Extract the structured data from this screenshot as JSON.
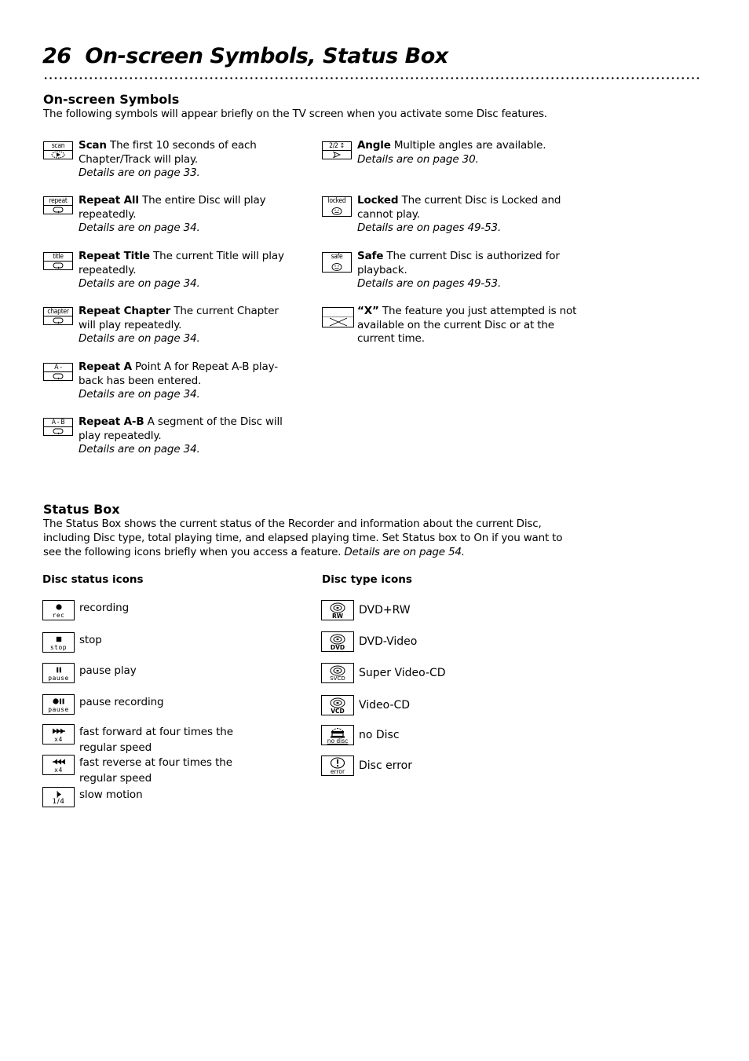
{
  "header": {
    "page_number": "26",
    "title": "On-screen Symbols, Status Box"
  },
  "onscreen": {
    "heading": "On-screen Symbols",
    "intro": "The following symbols will appear briefly on the TV screen when you activate some Disc features.",
    "left": [
      {
        "icon_label": "scan",
        "icon": "scan-play-icon",
        "name": "Scan",
        "desc": " The first 10 seconds of each Chapter/Track will play.",
        "details": "Details are on page 33."
      },
      {
        "icon_label": "repeat",
        "icon": "repeat-icon",
        "name": "Repeat All",
        "desc": " The entire Disc will play repeatedly.",
        "details": "Details are on page 34."
      },
      {
        "icon_label": "title",
        "icon": "repeat-icon",
        "name": "Repeat Title",
        "desc": " The current Title will play repeatedly.",
        "details": "Details are on page 34."
      },
      {
        "icon_label": "chapter",
        "icon": "repeat-icon",
        "name": "Repeat Chapter",
        "desc": " The current Chapter will play repeatedly.",
        "details": "Details are on page 34."
      },
      {
        "icon_label": "A -",
        "icon": "repeat-icon",
        "name": "Repeat A",
        "desc": "  Point A for Repeat A-B play-back has been entered.",
        "details": "Details are on page 34."
      },
      {
        "icon_label": "A - B",
        "icon": "repeat-icon",
        "name": "Repeat A-B",
        "desc": " A segment of the Disc will play repeatedly.",
        "details": "Details are on page 34."
      }
    ],
    "right": [
      {
        "icon_label": "2/2 ↕",
        "icon": "angle-icon",
        "name": "Angle",
        "desc": " Multiple angles are available.",
        "details": "Details are on page 30."
      },
      {
        "icon_label": "locked",
        "icon": "sad-face-icon",
        "name": "Locked",
        "desc": " The current Disc is Locked and cannot play.",
        "details": "Details are on pages 49-53."
      },
      {
        "icon_label": "safe",
        "icon": "smiley-face-icon",
        "name": "Safe",
        "desc": " The current Disc is authorized for playback.",
        "details": "Details are on pages 49-53."
      },
      {
        "icon_label": "",
        "icon": "x-icon",
        "name": "“X”",
        "desc": " The feature you just attempted is not available on the current Disc or at the current time.",
        "details": ""
      }
    ]
  },
  "status_box": {
    "heading": "Status Box",
    "intro": "The Status Box shows the current status of the Recorder and information about the current Disc, including Disc type, total playing time, and elapsed playing time. Set Status box to On if you want to see the following icons briefly when you access a feature. ",
    "intro_details": "Details are on page 54.",
    "status_heading": "Disc status icons",
    "type_heading": "Disc type icons",
    "status_icons": [
      {
        "caption": "rec",
        "icon": "record-dot-icon",
        "label": "recording"
      },
      {
        "caption": "stop",
        "icon": "stop-square-icon",
        "label": "stop"
      },
      {
        "caption": "pause",
        "icon": "pause-icon",
        "label": "pause play"
      },
      {
        "caption": "pause",
        "icon": "record-pause-icon",
        "label": "pause recording"
      },
      {
        "caption": "x4",
        "icon": "fast-forward-icon",
        "label": "fast forward at four times the regular speed"
      },
      {
        "caption": "x4",
        "icon": "fast-reverse-icon",
        "label": "fast reverse at four times the regular speed"
      },
      {
        "caption": "1/4",
        "icon": "slow-motion-icon",
        "label": "slow motion"
      }
    ],
    "type_icons": [
      {
        "caption": "RW",
        "icon": "disc-icon",
        "label": "DVD+RW"
      },
      {
        "caption": "DVD",
        "icon": "disc-icon",
        "label": "DVD-Video"
      },
      {
        "caption": "SVCD",
        "icon": "disc-icon",
        "label": "Super Video-CD"
      },
      {
        "caption": "VCD",
        "icon": "disc-icon",
        "label": "Video-CD"
      },
      {
        "caption": "no disc",
        "icon": "tray-eject-icon",
        "label": "no Disc"
      },
      {
        "caption": "error",
        "icon": "exclamation-icon",
        "label": "Disc error"
      }
    ]
  }
}
